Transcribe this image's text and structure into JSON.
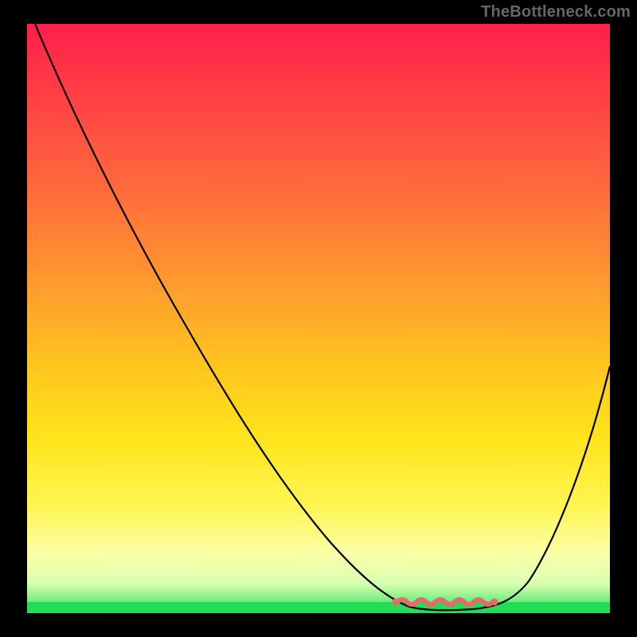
{
  "watermark": "TheBottleneck.com",
  "chart_data": {
    "type": "line",
    "title": "",
    "xlabel": "",
    "ylabel": "",
    "xlim": [
      0,
      100
    ],
    "ylim": [
      0,
      100
    ],
    "series": [
      {
        "name": "bottleneck-curve",
        "x": [
          0,
          5,
          10,
          15,
          20,
          25,
          30,
          35,
          40,
          45,
          50,
          55,
          60,
          63,
          66,
          70,
          74,
          78,
          82,
          86,
          90,
          95,
          100
        ],
        "values": [
          100,
          95,
          89,
          83,
          77,
          71,
          64,
          57,
          50,
          42,
          34,
          25,
          15,
          8,
          3,
          0.5,
          0,
          0,
          0.5,
          3,
          10,
          25,
          45
        ]
      },
      {
        "name": "optimal-range-marker",
        "x": [
          63,
          66,
          70,
          74,
          78,
          82
        ],
        "values": [
          1.5,
          1.2,
          1.0,
          1.0,
          1.2,
          1.5
        ]
      }
    ],
    "background_gradient": {
      "top": "#ff1f4b",
      "mid1": "#ff9a2e",
      "mid2": "#ffe31a",
      "mid3": "#fbffa8",
      "bottom": "#22dd55"
    },
    "marker_color": "#e76a6a",
    "curve_color": "#000000"
  }
}
